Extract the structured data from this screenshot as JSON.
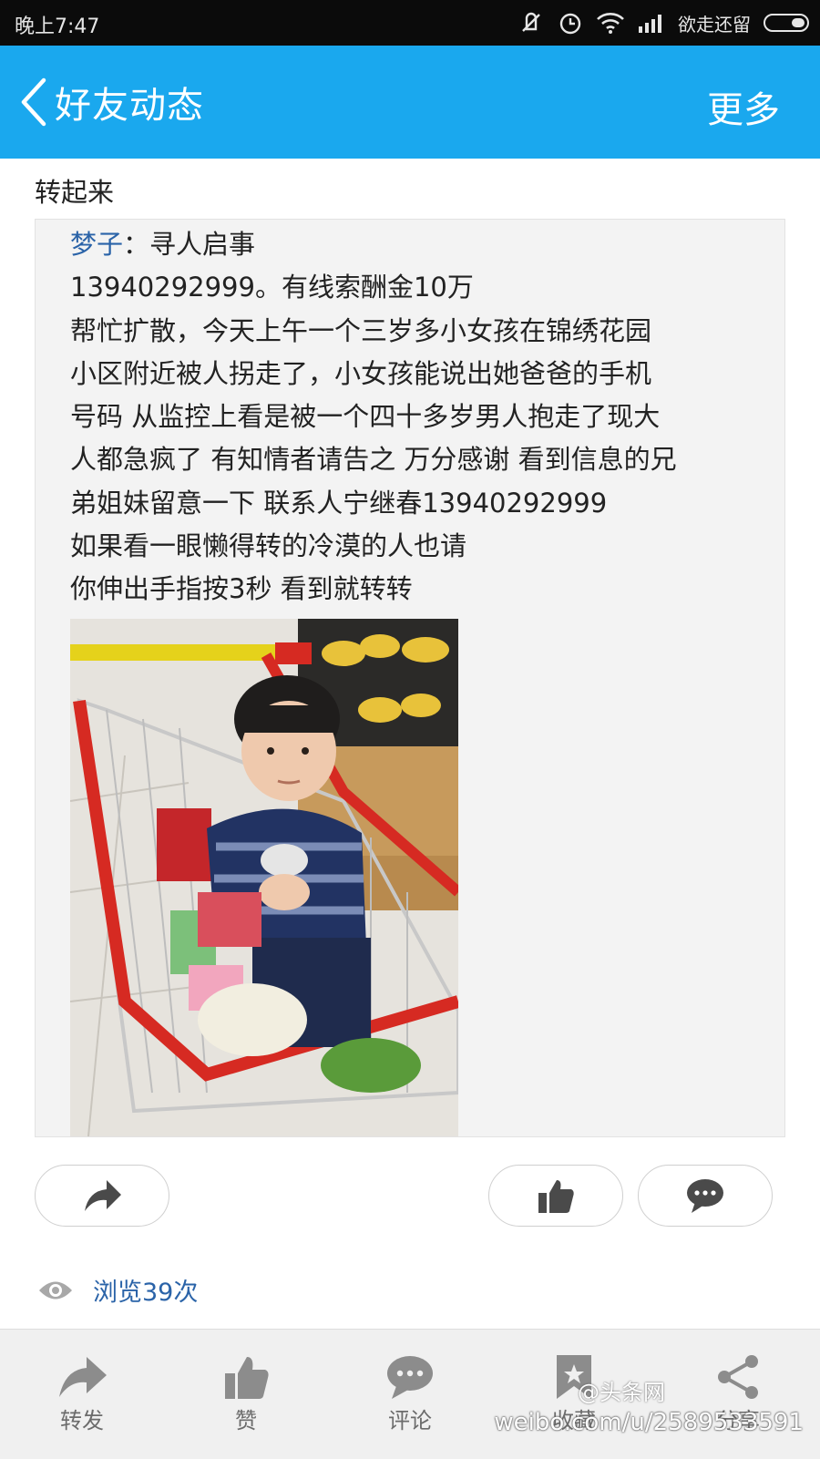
{
  "status_bar": {
    "time": "晚上7:47",
    "carrier": "欲走还留"
  },
  "title_bar": {
    "title": "好友动态",
    "more": "更多"
  },
  "post": {
    "header_text": "转起来",
    "quote": {
      "author": "梦子",
      "title_rest": "：寻人启事",
      "lines": [
        "13940292999。有线索酬金10万",
        "帮忙扩散，今天上午一个三岁多小女孩在锦绣花园",
        "小区附近被人拐走了，小女孩能说出她爸爸的手机",
        "号码 从监控上看是被一个四十多岁男人抱走了现大",
        "人都急疯了 有知情者请告之 万分感谢 看到信息的兄",
        "弟姐妹留意一下 联系人宁继春13940292999",
        "如果看一眼懒得转的冷漠的人也请",
        "你伸出手指按3秒 看到就转转"
      ]
    },
    "views": "浏览39次"
  },
  "toolbar": {
    "items": [
      {
        "label": "转发",
        "icon": "forward-icon"
      },
      {
        "label": "赞",
        "icon": "thumbs-up-icon"
      },
      {
        "label": "评论",
        "icon": "comment-icon"
      },
      {
        "label": "收藏",
        "icon": "bookmark-icon"
      },
      {
        "label": "分享",
        "icon": "share-icon"
      }
    ]
  },
  "watermark": {
    "logo": "@头条网",
    "url": "weibo.com/u/2589533591"
  },
  "colors": {
    "title_bar": "#1aa8ee",
    "status_bar": "#0b0b0b",
    "link": "#2a63a8",
    "quote_bg": "#f3f3f3",
    "toolbar_bg": "#f0f0f0"
  }
}
